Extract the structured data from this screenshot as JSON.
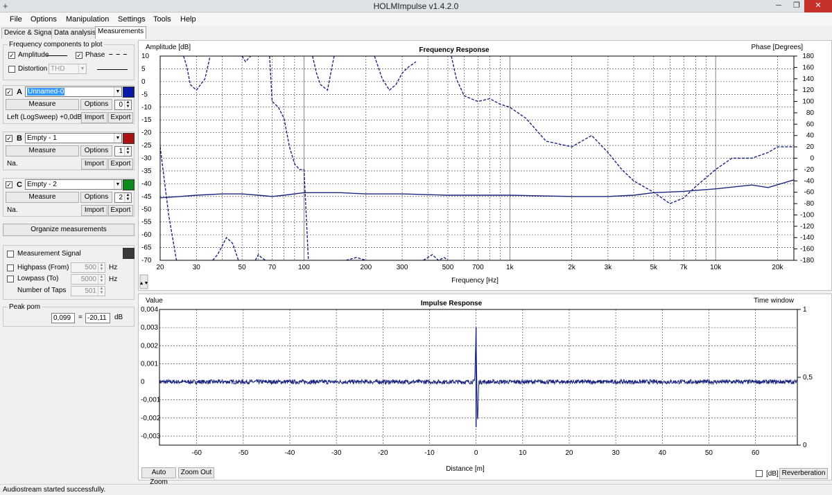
{
  "window": {
    "title": "HOLMImpulse  v1.4.2.0",
    "minimize": "─",
    "maximize": "❐",
    "close": "✕",
    "app_icon": "+"
  },
  "menu": [
    "File",
    "Options",
    "Manipulation",
    "Settings",
    "Tools",
    "Help"
  ],
  "tabs": [
    "Device & Signal",
    "Data analysis",
    "Measurements"
  ],
  "active_tab": "Measurements",
  "left_panel": {
    "freq_components": {
      "legend": "Frequency components to plot",
      "amplitude_label": "Amplitude",
      "amplitude_checked": true,
      "phase_label": "Phase",
      "phase_checked": true,
      "distortion_label": "Distortion",
      "distortion_checked": false,
      "distortion_select": "THD"
    },
    "measurements": [
      {
        "letter": "A",
        "checked": true,
        "name": "Unnamed-0",
        "color": "#0a1aa6",
        "measure_label": "Measure",
        "options_label": "Options",
        "spin": "0",
        "info": "Left (LogSweep) +0,0dB",
        "import_label": "Import",
        "export_label": "Export"
      },
      {
        "letter": "B",
        "checked": true,
        "name": "Empty - 1",
        "color": "#a81414",
        "measure_label": "Measure",
        "options_label": "Options",
        "spin": "1",
        "info": "Na.",
        "import_label": "Import",
        "export_label": "Export"
      },
      {
        "letter": "C",
        "checked": true,
        "name": "Empty - 2",
        "color": "#0c8a1c",
        "measure_label": "Measure",
        "options_label": "Options",
        "spin": "2",
        "info": "Na.",
        "import_label": "Import",
        "export_label": "Export"
      }
    ],
    "organize_label": "Organize measurements",
    "signal": {
      "label": "Measurement Signal",
      "checked": false,
      "swatch_color": "#3a3a3a",
      "highpass_label": "Highpass (From)",
      "highpass_checked": false,
      "highpass_value": "500",
      "highpass_unit": "Hz",
      "lowpass_label": "Lowpass (To)",
      "lowpass_checked": false,
      "lowpass_value": "5000",
      "lowpass_unit": "Hz",
      "taps_label": "Number of Taps",
      "taps_value": "501"
    },
    "peak": {
      "legend": "Peak pom",
      "value1": "0,099",
      "eq": "=",
      "value2": "-20,11",
      "unit": "dB"
    }
  },
  "freq_chart": {
    "title": "Frequency Response",
    "left_label": "Amplitude [dB]",
    "right_label": "Phase [Degrees]",
    "xlabel": "Frequency [Hz]",
    "left_ticks": [
      "10",
      "5",
      "0",
      "-5",
      "-10",
      "-15",
      "-20",
      "-25",
      "-30",
      "-35",
      "-40",
      "-45",
      "-50",
      "-55",
      "-60",
      "-65",
      "-70"
    ],
    "right_ticks": [
      "180",
      "160",
      "140",
      "120",
      "100",
      "80",
      "60",
      "40",
      "20",
      "0",
      "-20",
      "-40",
      "-60",
      "-80",
      "-100",
      "-120",
      "-140",
      "-160",
      "-180"
    ],
    "x_ticks": [
      "20",
      "30",
      "50",
      "70",
      "100",
      "200",
      "300",
      "500",
      "700",
      "1k",
      "2k",
      "3k",
      "5k",
      "7k",
      "10k",
      "20k"
    ],
    "arrow_icon": "▲▼"
  },
  "imp_chart": {
    "title": "Impulse Response",
    "left_label": "Value",
    "right_label": "Time window",
    "xlabel": "Distance [m]",
    "left_ticks": [
      "0,004",
      "0,003",
      "0,002",
      "0,001",
      "0",
      "-0,001",
      "-0,002",
      "-0,003"
    ],
    "right_ticks": [
      "1",
      "0,5",
      "0"
    ],
    "x_ticks": [
      "-60",
      "-50",
      "-40",
      "-30",
      "-20",
      "-10",
      "0",
      "10",
      "20",
      "30",
      "40",
      "50",
      "60"
    ],
    "auto_zoom_label": "Auto Zoom",
    "zoom_out_label": "Zoom Out",
    "db_label": "[dB]",
    "db_checked": false,
    "reverberation_label": "Reverberation"
  },
  "chart_data": [
    {
      "type": "line",
      "title": "Frequency Response",
      "xlabel": "Frequency [Hz]",
      "ylabel": "Amplitude [dB]",
      "y2label": "Phase [Degrees]",
      "xscale": "log",
      "xlim": [
        20,
        24000
      ],
      "ylim": [
        -70,
        10
      ],
      "y2lim": [
        -180,
        180
      ],
      "grid": true,
      "series": [
        {
          "line": "solid",
          "axis": "left",
          "x": [
            20,
            25,
            30,
            40,
            50,
            60,
            70,
            80,
            100,
            150,
            200,
            300,
            500,
            700,
            1000,
            2000,
            3000,
            4000,
            5000,
            7000,
            10000,
            15000,
            18000,
            24000
          ],
          "y": [
            -45.5,
            -45,
            -44.5,
            -44,
            -44,
            -44.5,
            -45,
            -44.5,
            -43.5,
            -43.5,
            -44,
            -44,
            -44.5,
            -44.5,
            -44.5,
            -45,
            -45,
            -44.5,
            -43.5,
            -43,
            -42,
            -40.5,
            -41.5,
            -38.5
          ]
        },
        {
          "line": "dashed",
          "axis": "right",
          "x": [
            20,
            22,
            24,
            26,
            27,
            28,
            30,
            33,
            35,
            36,
            38,
            40,
            42,
            45,
            48,
            50,
            52,
            55,
            58,
            60,
            62,
            65,
            68,
            70,
            75,
            80,
            85,
            90,
            95,
            100,
            105,
            110,
            115,
            120,
            130,
            140,
            160,
            180,
            200,
            220,
            240,
            260,
            280,
            300,
            320,
            350,
            380,
            400,
            420,
            450,
            480,
            500,
            520,
            550,
            600,
            700,
            800,
            900,
            1000,
            1200,
            1500,
            2000,
            2500,
            3000,
            3500,
            4000,
            5000,
            6000,
            7000,
            8000,
            10000,
            12000,
            15000,
            18000,
            20000,
            24000
          ],
          "y": [
            20,
            -100,
            -180,
            180,
            160,
            130,
            120,
            140,
            180,
            -180,
            -170,
            -155,
            -140,
            -150,
            -180,
            180,
            170,
            180,
            -180,
            -170,
            -175,
            -180,
            180,
            100,
            90,
            70,
            20,
            -10,
            -20,
            -20,
            -180,
            180,
            150,
            130,
            120,
            180,
            -180,
            -175,
            -180,
            180,
            140,
            120,
            130,
            150,
            160,
            170,
            -180,
            -175,
            -170,
            -180,
            -175,
            -180,
            180,
            140,
            110,
            100,
            105,
            95,
            90,
            70,
            30,
            20,
            40,
            10,
            -20,
            -40,
            -60,
            -80,
            -70,
            -50,
            -20,
            0,
            0,
            10,
            20,
            20
          ]
        }
      ]
    },
    {
      "type": "line",
      "title": "Impulse Response",
      "xlabel": "Distance [m]",
      "ylabel": "Value",
      "y2label": "Time window",
      "xlim": [
        -68,
        69
      ],
      "ylim": [
        -0.0035,
        0.004
      ],
      "y2lim": [
        0,
        1
      ],
      "grid": true,
      "series": [
        {
          "line": "solid",
          "noise_amplitude": 0.00012,
          "x": [
            -68,
            -0.3,
            0,
            0.3,
            0.6,
            69
          ],
          "y": [
            0,
            0,
            0.003,
            -0.0025,
            0,
            0
          ]
        }
      ]
    }
  ]
}
